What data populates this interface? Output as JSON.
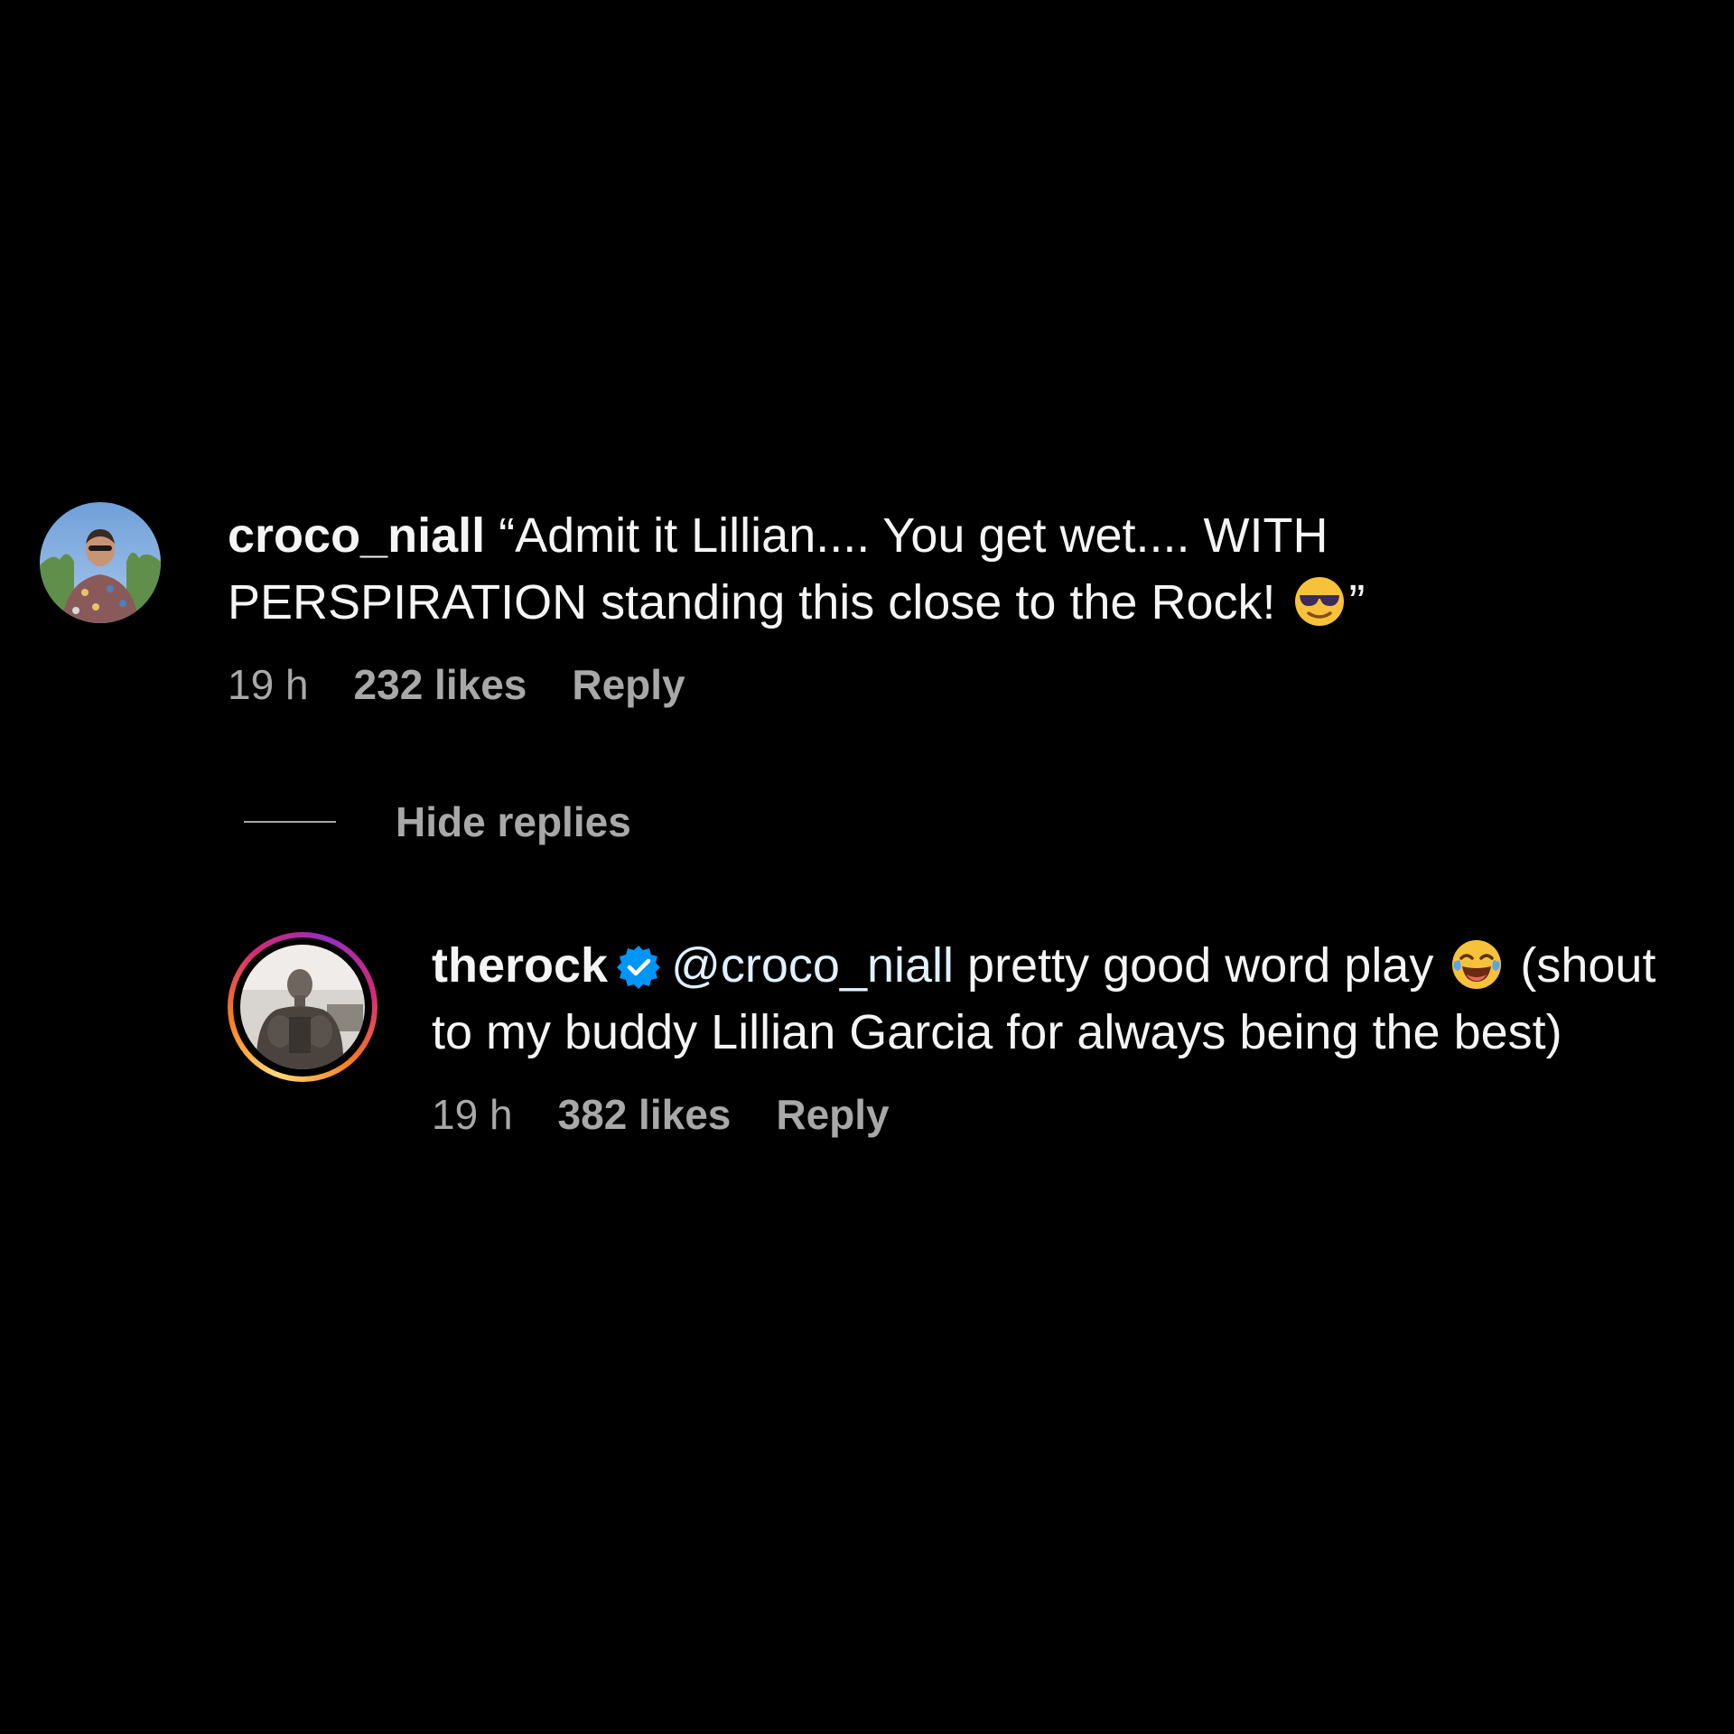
{
  "comments": [
    {
      "username": "croco_niall",
      "text_before_emoji": "“Admit it Lillian.... You get wet.... WITH PERSPIRATION standing this close to the Rock!",
      "emoji": "smiling-face-with-sunglasses",
      "text_after_emoji": "”",
      "time": "19 h",
      "likes": "232 likes",
      "reply_label": "Reply"
    }
  ],
  "hide_replies_label": "Hide replies",
  "replies": [
    {
      "username": "therock",
      "verified": true,
      "mention": "@croco_niall",
      "text_before_emoji": "pretty good word play",
      "emoji": "face-with-tears-of-joy",
      "text_after_emoji": "(shout to my buddy Lillian Garcia for always being the best)",
      "time": "19 h",
      "likes": "382 likes",
      "reply_label": "Reply"
    }
  ],
  "colors": {
    "background": "#000000",
    "primary_text": "#f5f5f5",
    "secondary_text": "#a8a8a8",
    "verified_badge": "#0095f6",
    "story_ring": [
      "#feda75",
      "#fa7e1e",
      "#d62976",
      "#962fbf"
    ]
  }
}
